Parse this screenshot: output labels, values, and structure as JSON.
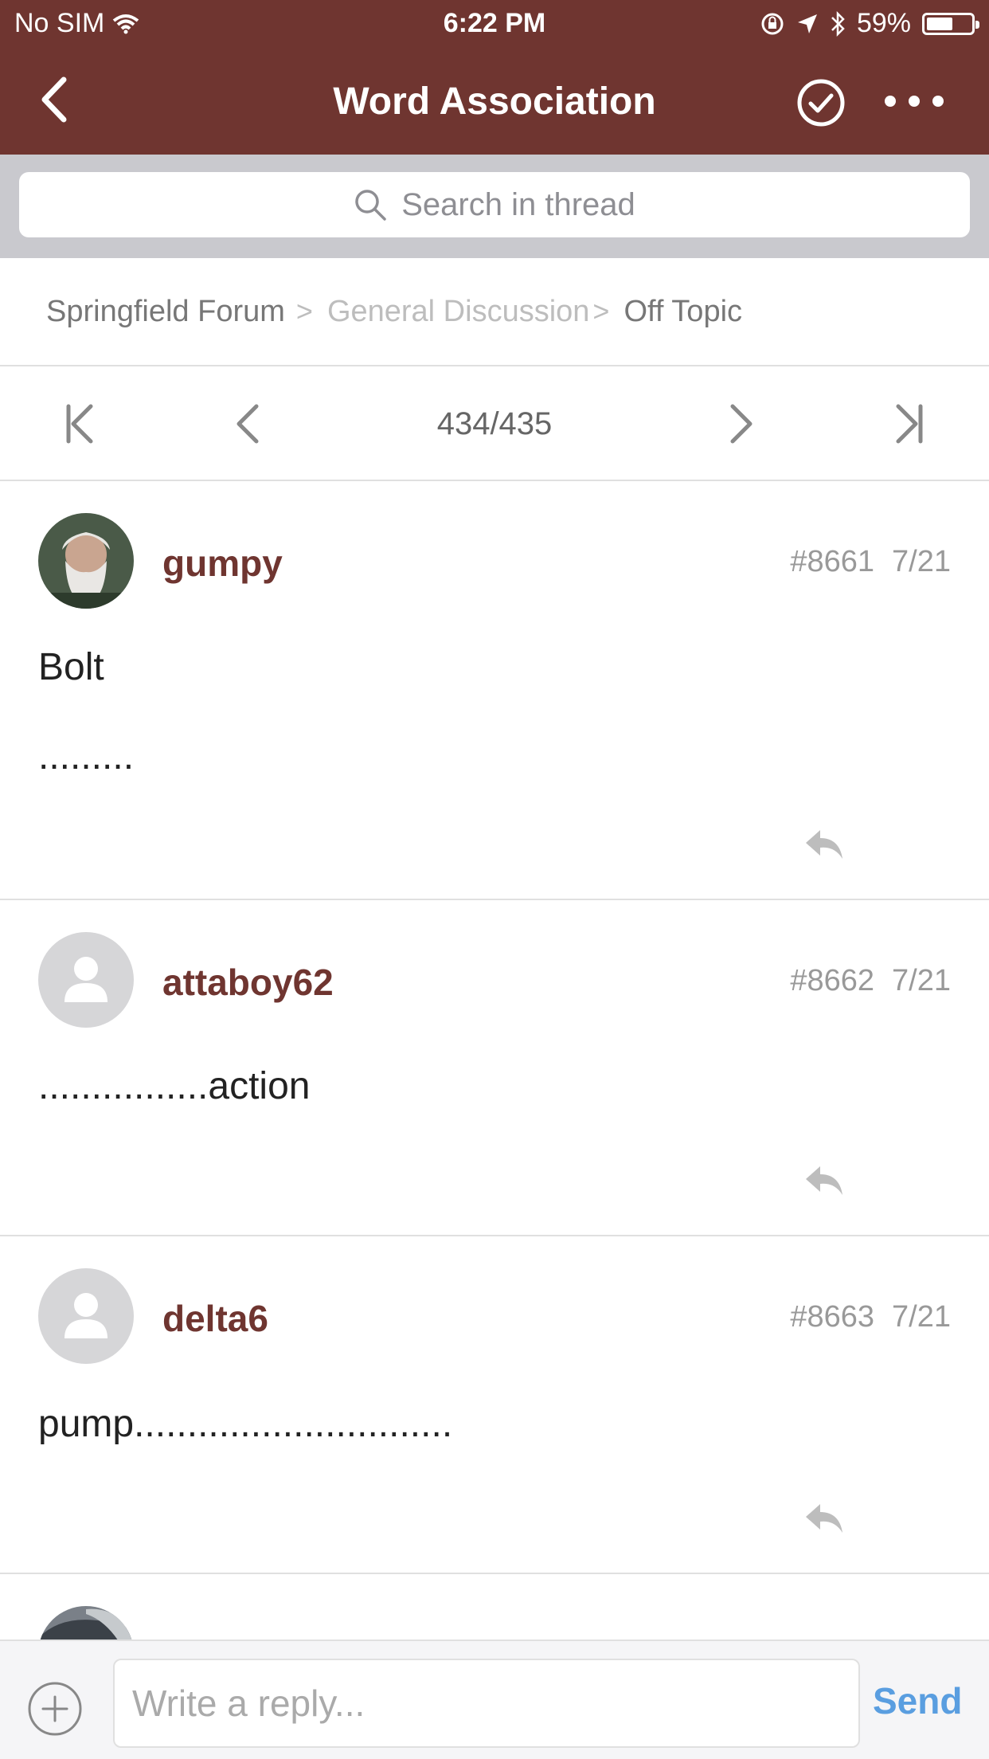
{
  "status_bar": {
    "carrier": "No SIM",
    "time": "6:22 PM",
    "battery_percent": "59%",
    "battery_level": 0.59
  },
  "nav": {
    "title": "Word Association",
    "back_icon": "chevron-left-icon",
    "check_icon": "checkmark-circle-icon",
    "more_icon": "more-dots-icon",
    "bar_color": "#6f3530"
  },
  "search": {
    "placeholder": "Search in thread"
  },
  "breadcrumb": [
    {
      "label": "Springfield Forum"
    },
    {
      "label": "General Discussion"
    },
    {
      "label": "Off Topic"
    }
  ],
  "pager": {
    "count": "434/435"
  },
  "posts": [
    {
      "username": "gumpy",
      "post_number": "#8661",
      "date": "7/21",
      "lines": [
        "Bolt",
        "........."
      ]
    },
    {
      "username": "attaboy62",
      "post_number": "#8662",
      "date": "7/21",
      "lines": [
        "................action"
      ]
    },
    {
      "username": "delta6",
      "post_number": "#8663",
      "date": "7/21",
      "lines": [
        "pump.............................."
      ]
    }
  ],
  "composer": {
    "placeholder": "Write a reply...",
    "send_label": "Send",
    "send_color": "#5a9ee0"
  },
  "colors": {
    "accent": "#6f3530",
    "username": "#6f3530",
    "muted": "#999999"
  }
}
